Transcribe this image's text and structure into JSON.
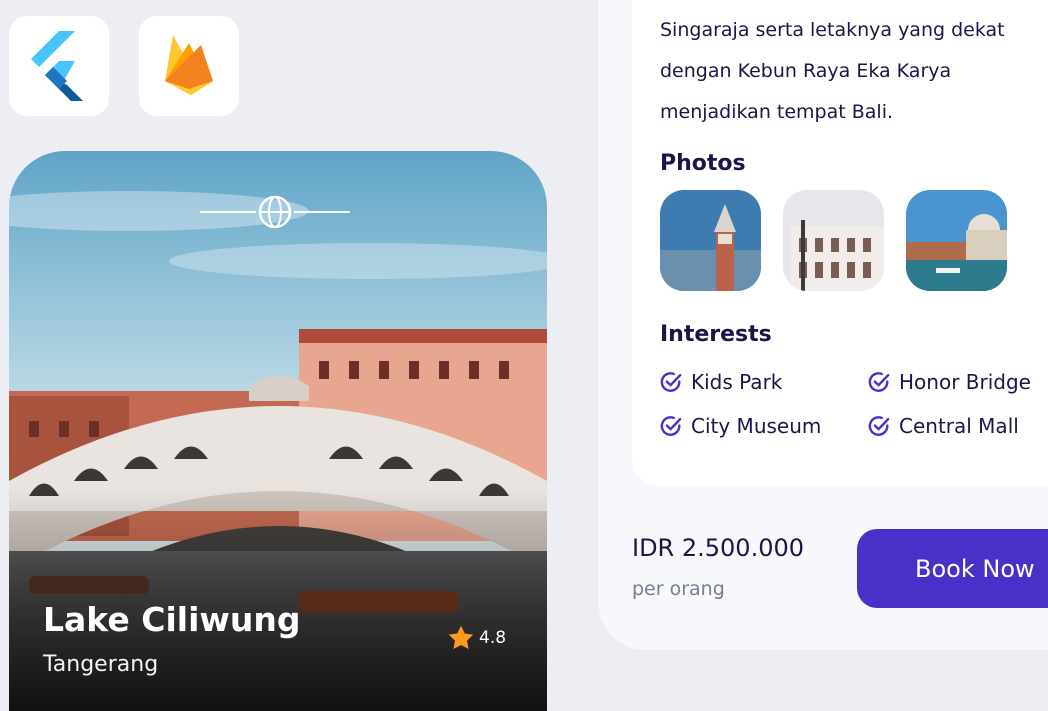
{
  "tech_logos": [
    {
      "name": "flutter-logo",
      "color": "#44c3f6"
    },
    {
      "name": "firebase-logo",
      "color": "#ffc62d"
    }
  ],
  "destination": {
    "title": "Lake Ciliwung",
    "location": "Tangerang",
    "rating": "4.8"
  },
  "about": {
    "lines": [
      "Singaraja serta letaknya yang dekat",
      "dengan Kebun Raya Eka Karya",
      "menjadikan tempat Bali."
    ]
  },
  "photos": {
    "title": "Photos",
    "items": [
      "bell-tower-photo",
      "venice-building-photo",
      "grand-canal-photo"
    ]
  },
  "interests": {
    "title": "Interests",
    "items": [
      "Kids Park",
      "Honor Bridge",
      "City Museum",
      "Central Mall"
    ]
  },
  "booking": {
    "price": "IDR 2.500.000",
    "per": "per orang",
    "button_label": "Book Now"
  },
  "colors": {
    "primary": "#4b2fc9",
    "text": "#1f1449",
    "rating_star": "#ff9a1f"
  }
}
